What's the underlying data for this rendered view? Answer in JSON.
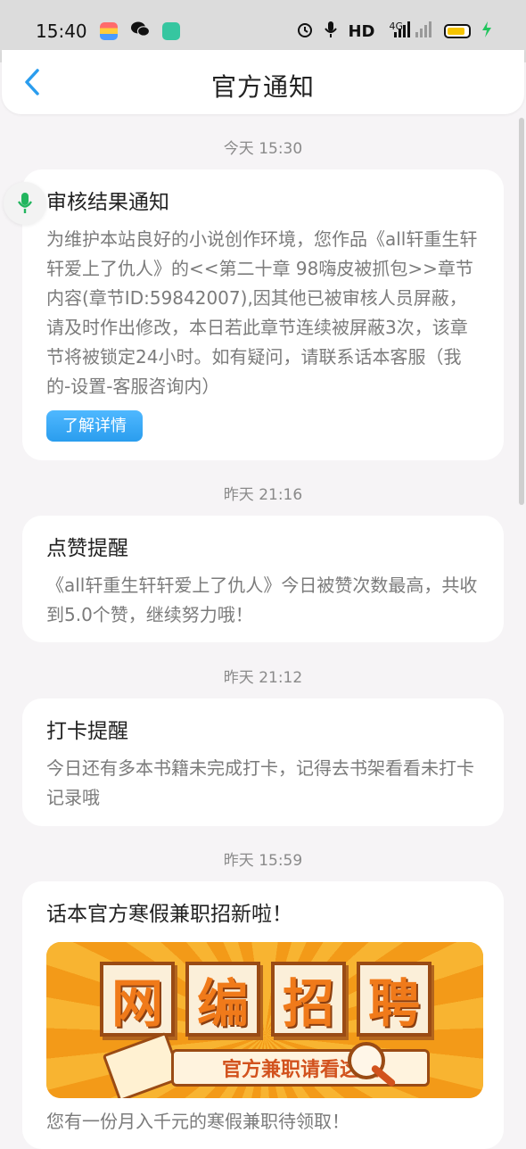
{
  "status_bar": {
    "time": "15:40",
    "hd_label": "HD",
    "network_label": "4G",
    "battery_color": "#f5c400"
  },
  "header": {
    "title": "官方通知"
  },
  "notifications": [
    {
      "time": "今天 15:30",
      "title": "审核结果通知",
      "body": "为维护本站良好的小说创作环境，您作品《all轩重生轩轩爱上了仇人》的<<第二十章 98嗨皮被抓包>>章节内容(章节ID:59842007),因其他已被审核人员屏蔽，请及时作出修改，本日若此章节连续被屏蔽3次，该章节将被锁定24小时。如有疑问，请联系话本客服（我的-设置-客服咨询内）",
      "button": "了解详情"
    },
    {
      "time": "昨天 21:16",
      "title": "点赞提醒",
      "body": "《all轩重生轩轩爱上了仇人》今日被赞次数最高，共收到5.0个赞，继续努力哦！"
    },
    {
      "time": "昨天 21:12",
      "title": "打卡提醒",
      "body": "今日还有多本书籍未完成打卡，记得去书架看看未打卡记录哦"
    },
    {
      "time": "昨天 15:59",
      "title": "话本官方寒假兼职招新啦！",
      "banner_chars": [
        "网",
        "编",
        "招",
        "聘"
      ],
      "banner_ribbon": "官方兼职请看这里",
      "body": "您有一份月入千元的寒假兼职待领取！"
    }
  ],
  "colors": {
    "accent": "#2a9dee",
    "mic_green": "#22b55e"
  }
}
